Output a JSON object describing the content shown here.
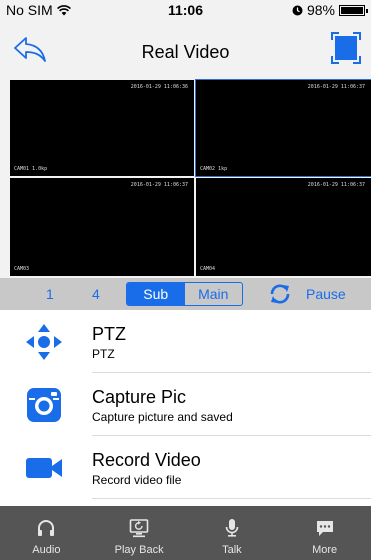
{
  "status": {
    "carrier": "No SIM",
    "time": "11:06",
    "battery": "98%",
    "battery_level": 0.98
  },
  "nav": {
    "title": "Real Video",
    "accent_color": "#1a6de8"
  },
  "video_cells": [
    {
      "time": "2016-01-29 11:06:36",
      "label": "CAM01 1.0kp"
    },
    {
      "time": "2016-01-29 11:06:37",
      "label": ""
    },
    {
      "time": "2016-01-29 11:06:37",
      "label": "CAM03"
    },
    {
      "time": "2016-01-29 11:06:37",
      "label": "CAM04"
    }
  ],
  "cell_label_2": "CAM02 1kp",
  "controls": {
    "one": "1",
    "four": "4",
    "sub": "Sub",
    "main": "Main",
    "pause": "Pause"
  },
  "list": [
    {
      "title": "PTZ",
      "subtitle": "PTZ",
      "icon": "ptz-arrows-icon"
    },
    {
      "title": "Capture Pic",
      "subtitle": "Capture picture and saved",
      "icon": "camera-icon"
    },
    {
      "title": "Record Video",
      "subtitle": "Record video file",
      "icon": "video-camera-icon"
    }
  ],
  "tabs": [
    {
      "label": "Audio",
      "icon": "headphones-icon"
    },
    {
      "label": "Play Back",
      "icon": "playback-icon"
    },
    {
      "label": "Talk",
      "icon": "microphone-icon"
    },
    {
      "label": "More",
      "icon": "chat-bubble-icon"
    }
  ]
}
